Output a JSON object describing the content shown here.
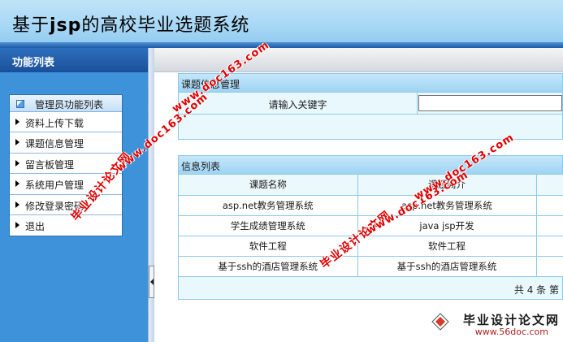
{
  "header": {
    "title_prefix": "基于",
    "title_bold": "jsp",
    "title_suffix": "的高校毕业选题系统"
  },
  "sidebar": {
    "title": "功能列表",
    "menu_title": "管理员功能列表",
    "items": [
      {
        "label": "资料上传下载"
      },
      {
        "label": "课题信息管理"
      },
      {
        "label": "留言板管理"
      },
      {
        "label": "系统用户管理"
      },
      {
        "label": "修改登录密码"
      },
      {
        "label": "退出"
      }
    ]
  },
  "search": {
    "header": "课题信息管理",
    "label": "请输入关键字",
    "value": "",
    "placeholder": ""
  },
  "list": {
    "header": "信息列表",
    "columns": [
      "课题名称",
      "课题简介",
      ""
    ],
    "rows": [
      [
        "asp.net教务管理系统",
        "asp.net教务管理系统",
        ""
      ],
      [
        "学生成绩管理系统",
        "java jsp开发",
        ""
      ],
      [
        "软件工程",
        "软件工程",
        ""
      ],
      [
        "基于ssh的酒店管理系统",
        "基于ssh的酒店管理系统",
        ""
      ]
    ],
    "pager": "共 4 条 第"
  },
  "watermarks": {
    "cn": "毕业设计论文网",
    "url": "www.doc163.com"
  },
  "corner_logo": {
    "cn": "毕业设计论文网",
    "url": "www.56doc.com"
  },
  "colors": {
    "header_bg": "#a9d8f5",
    "sidebar_bg": "#3e92d9",
    "panel_header_bg": "#b2ddf7",
    "watermark": "#e00000"
  }
}
